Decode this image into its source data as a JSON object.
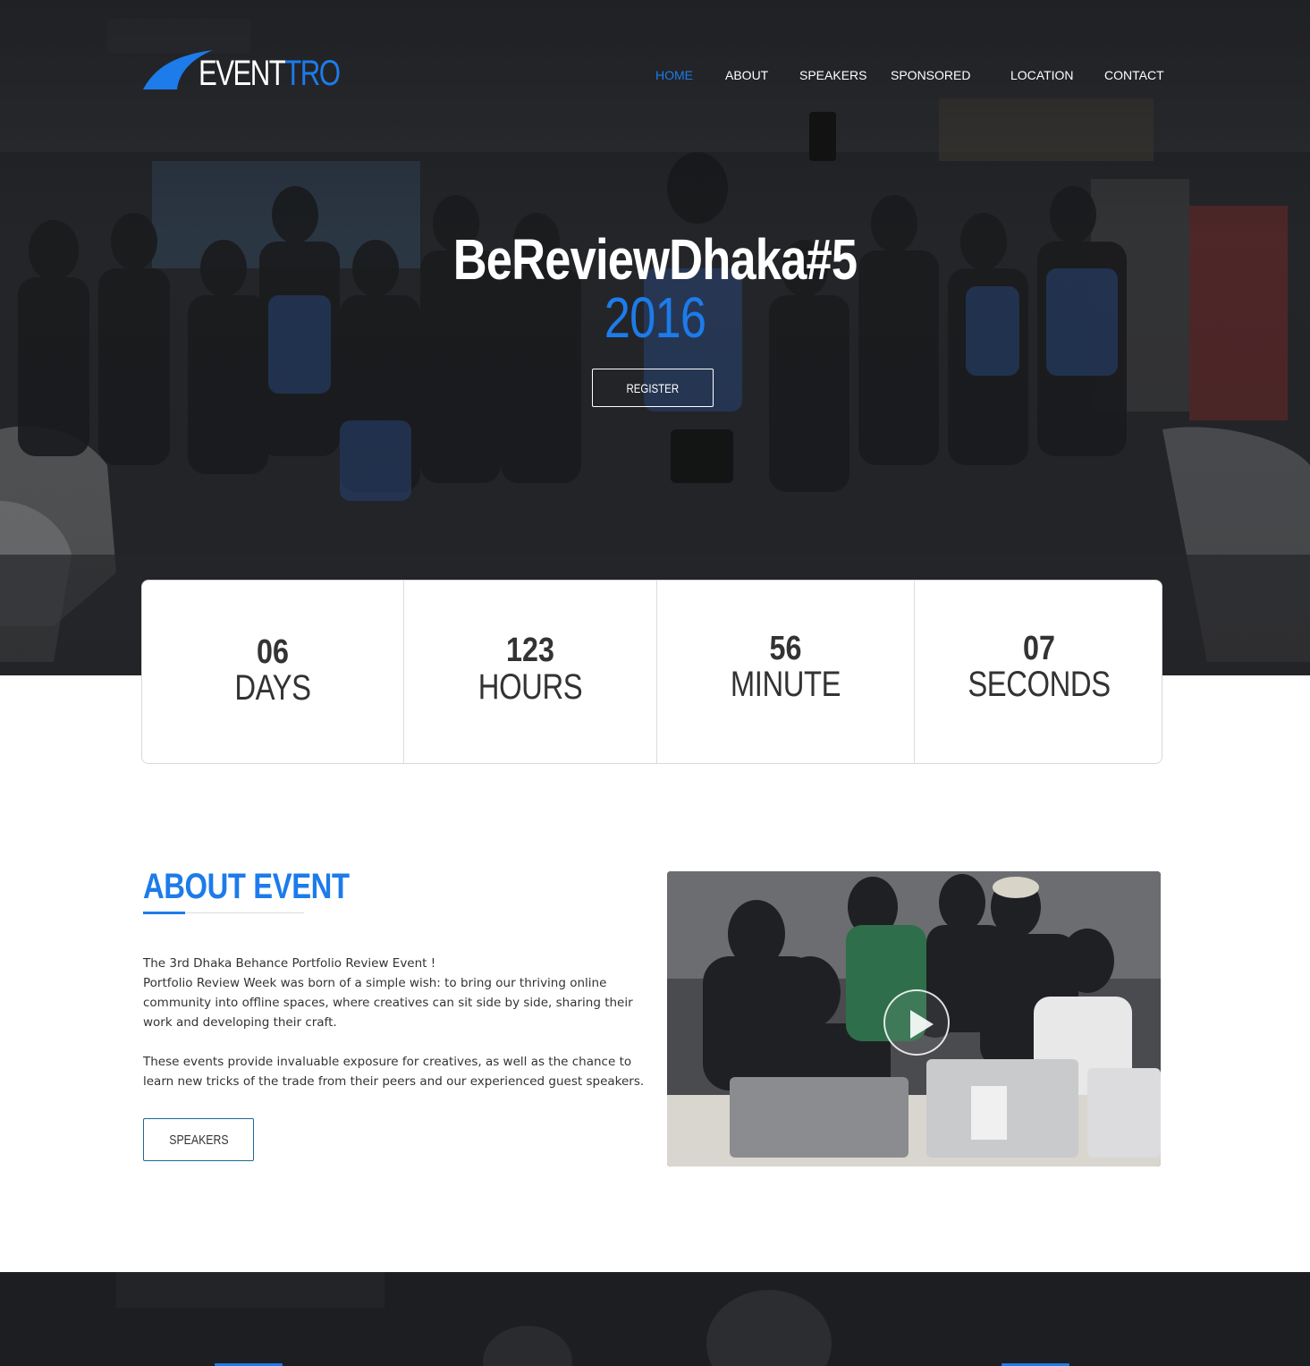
{
  "brand": {
    "logo_white": "EVENT",
    "logo_blue": "TRO",
    "accent": "#1d7bea"
  },
  "nav": {
    "items": [
      {
        "label": "HOME",
        "active": true
      },
      {
        "label": "ABOUT",
        "active": false
      },
      {
        "label": "SPEAKERS",
        "active": false
      },
      {
        "label": "SPONSORED",
        "active": false
      },
      {
        "label": "LOCATION",
        "active": false
      },
      {
        "label": "CONTACT",
        "active": false
      }
    ]
  },
  "hero": {
    "title": "BeReviewDhaka#5",
    "year": "2016",
    "register_label": "REGISTER"
  },
  "countdown": {
    "days": {
      "value": "06",
      "label": "DAYS"
    },
    "hours": {
      "value": "123",
      "label": "HOURS"
    },
    "minutes": {
      "value": "56",
      "label": "MINUTE"
    },
    "seconds": {
      "value": "07",
      "label": "SECONDS"
    }
  },
  "about": {
    "title": "ABOUT EVENT",
    "paragraph1_line1": "The 3rd  Dhaka Behance Portfolio Review Event !",
    "paragraph1_rest": "Portfolio Review Week was born of a simple wish: to bring our thriving online community into offline spaces, where creatives can sit side by side, sharing their work and developing their craft.",
    "paragraph2": "These events provide invaluable exposure for creatives, as well as the chance to learn new tricks of the trade from their peers and our experienced guest speakers.",
    "button_label": "SPEAKERS"
  },
  "icons": {
    "play": "play-icon",
    "logo_swoosh": "swoosh-icon"
  }
}
